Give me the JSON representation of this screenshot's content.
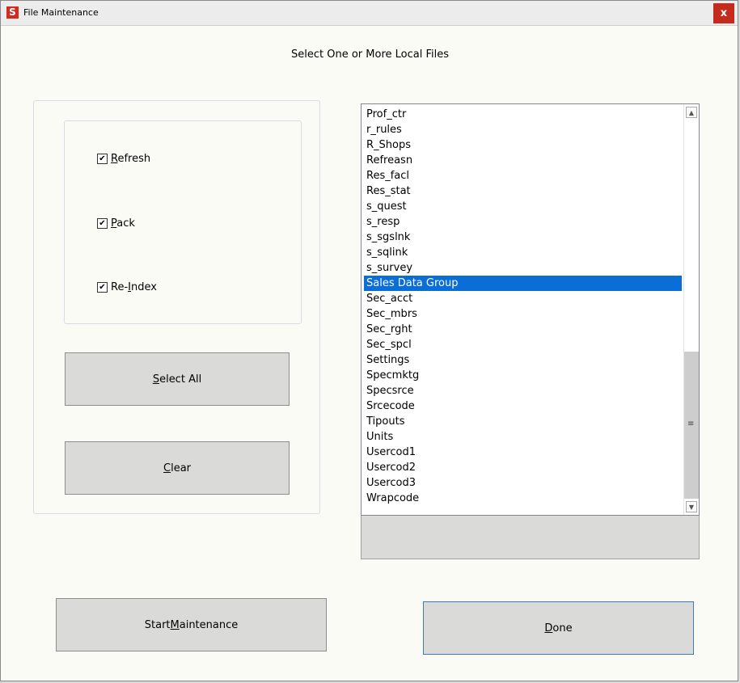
{
  "window": {
    "title": "File Maintenance",
    "app_icon_letter": "S",
    "close_glyph": "x"
  },
  "heading": "Select One or More Local Files",
  "options": [
    {
      "label_pre": "",
      "label_ul": "R",
      "label_post": "efresh",
      "checked": true
    },
    {
      "label_pre": "",
      "label_ul": "P",
      "label_post": "ack",
      "checked": true
    },
    {
      "label_pre": "Re-",
      "label_ul": "I",
      "label_post": "ndex",
      "checked": true
    }
  ],
  "buttons": {
    "select_all": {
      "pre": "",
      "ul": "S",
      "post": "elect All"
    },
    "clear": {
      "pre": "",
      "ul": "C",
      "post": "lear"
    },
    "start": {
      "pre": "Start ",
      "ul": "M",
      "post": "aintenance"
    },
    "done": {
      "pre": "",
      "ul": "D",
      "post": "one"
    }
  },
  "files": {
    "items": [
      "Prof_ctr",
      "r_rules",
      "R_Shops",
      "Refreasn",
      "Res_facl",
      "Res_stat",
      "s_quest",
      "s_resp",
      "s_sgslnk",
      "s_sqlink",
      "s_survey",
      "Sales Data Group",
      "Sec_acct",
      "Sec_mbrs",
      "Sec_rght",
      "Sec_spcl",
      "Settings",
      "Specmktg",
      "Specsrce",
      "Srcecode",
      "Tipouts",
      "Units",
      "Usercod1",
      "Usercod2",
      "Usercod3",
      "Wrapcode"
    ],
    "selected": "Sales Data Group"
  },
  "icons": {
    "check": "check-icon",
    "scroll_up": "scroll-up-arrow-icon",
    "scroll_down": "scroll-down-arrow-icon",
    "grip": "scroll-grip-icon"
  },
  "colors": {
    "selection": "#0a6ed6",
    "close": "#c42b1c",
    "app_icon": "#d42a1e"
  }
}
